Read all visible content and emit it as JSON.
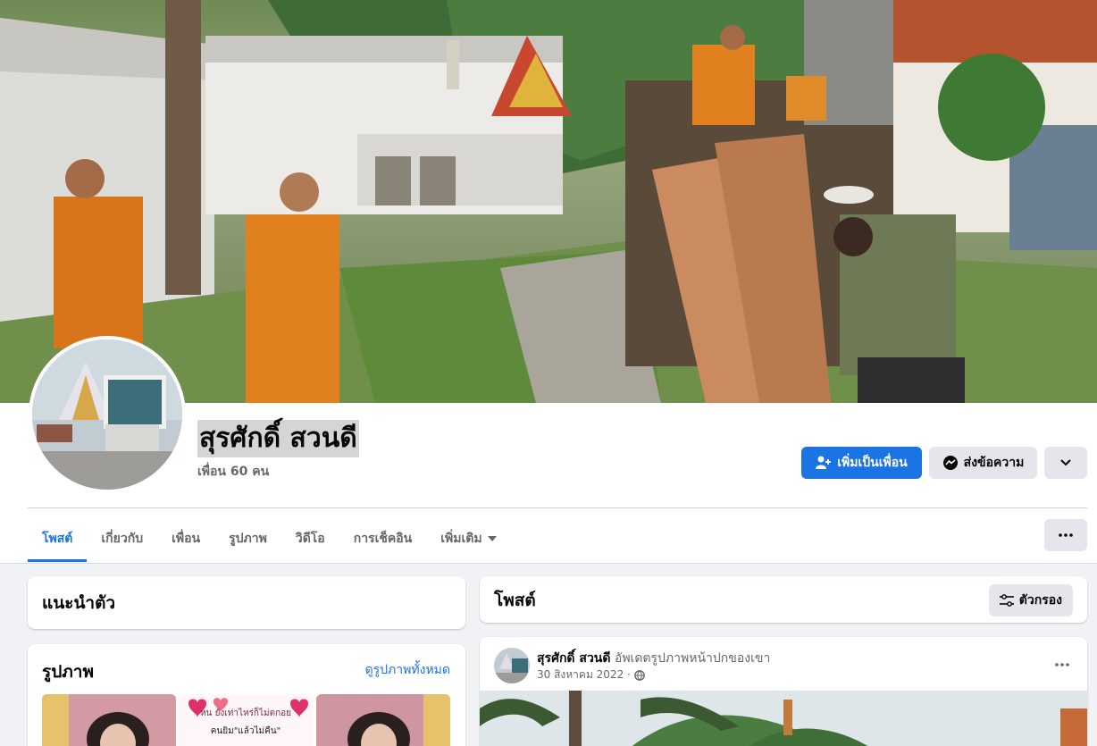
{
  "profile": {
    "name": "สุรศักดิ์ สวนดี",
    "friends": "เพื่อน 60 คน"
  },
  "actions": {
    "add_friend": "เพิ่มเป็นเพื่อน",
    "message": "ส่งข้อความ"
  },
  "tabs": [
    {
      "label": "โพสต์",
      "active": true
    },
    {
      "label": "เกี่ยวกับ",
      "active": false
    },
    {
      "label": "เพื่อน",
      "active": false
    },
    {
      "label": "รูปภาพ",
      "active": false
    },
    {
      "label": "วิดีโอ",
      "active": false
    },
    {
      "label": "การเช็คอิน",
      "active": false
    },
    {
      "label": "เพิ่มเติม",
      "active": false
    }
  ],
  "intro": {
    "title": "แนะนำตัว"
  },
  "photos": {
    "title": "รูปภาพ",
    "see_all": "ดูรูปภาพทั้งหมด",
    "thumb_text": [
      "หน ยังเท่าไหร่ก็ไม่ตกอย",
      "คนยิม\"แล้วไม่คืน\""
    ]
  },
  "posts": {
    "title": "โพสต์",
    "filter": "ตัวกรอง"
  },
  "post": {
    "author": "สุรศักดิ์ สวนดี",
    "action": "อัพเดตรูปภาพหน้าปกของเขา",
    "date": "30 สิงหาคม 2022 ·"
  },
  "colors": {
    "accent": "#1b74e4",
    "background": "#f0f2f5",
    "robe": "#e0801e"
  }
}
